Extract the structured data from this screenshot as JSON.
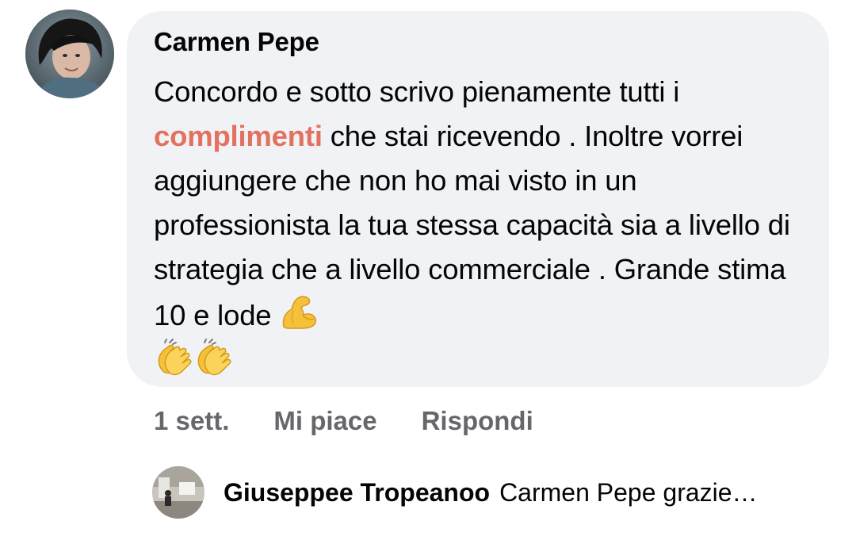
{
  "comment": {
    "author": "Carmen Pepe",
    "text_before_highlight": "Concordo e sotto scrivo pienamente tutti i ",
    "highlight": "complimenti",
    "text_after_highlight": " che stai ricevendo . Inoltre vorrei aggiungere che non ho mai visto in un professionista la tua stessa capacità sia a livello di strategia che a livello commerciale . Grande stima 10 e lode ",
    "emoji": [
      "flexed-biceps-icon",
      "clapping-hands-icon",
      "clapping-hands-icon"
    ]
  },
  "actions": {
    "time": "1 sett.",
    "like_label": "Mi piace",
    "reply_label": "Rispondi"
  },
  "reply_preview": {
    "author": "Giuseppee Tropeanoo",
    "text": "Carmen Pepe grazie…"
  },
  "colors": {
    "bubble": "#f0f2f5",
    "highlight": "#e4705f",
    "secondary_text": "#65676b",
    "emoji_yellow": "#f6c13a"
  }
}
